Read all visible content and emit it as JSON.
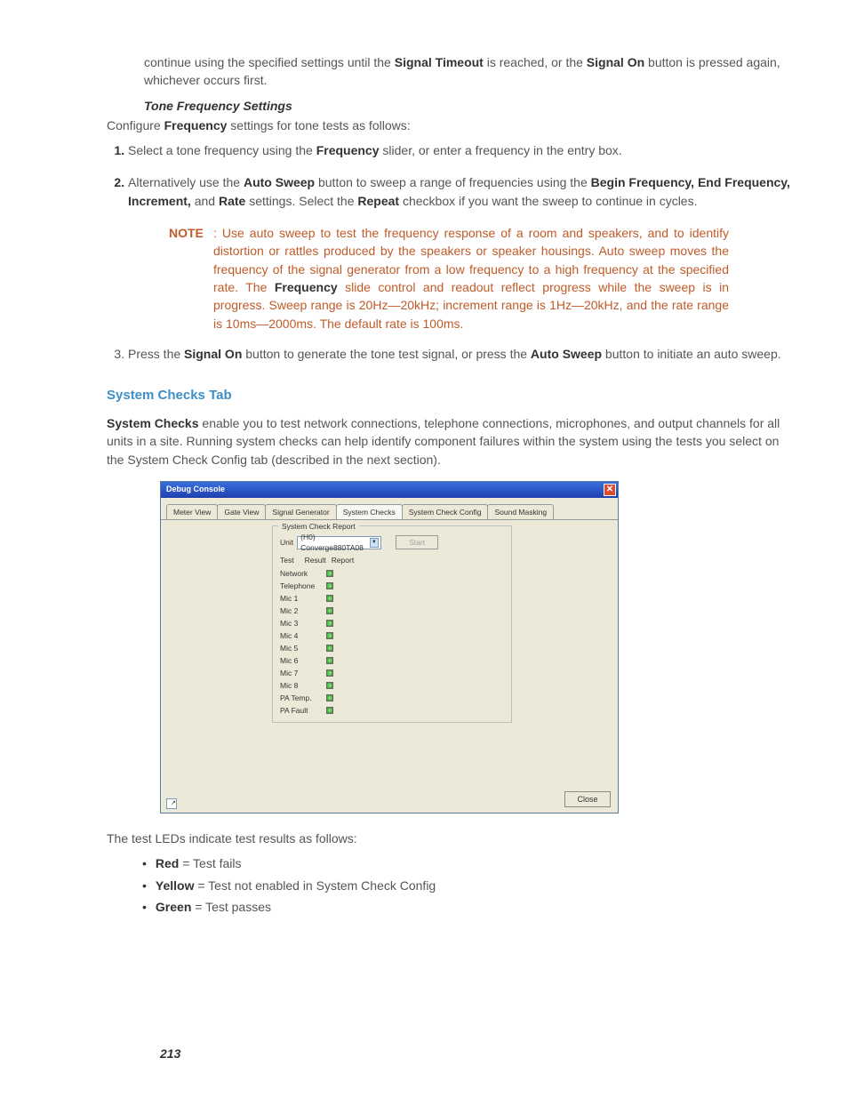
{
  "para_continue_1": "continue using the specified settings until the ",
  "signal_timeout": "Signal Timeout",
  "para_continue_2": " is reached, or the ",
  "signal_on": "Signal On",
  "para_continue_3": " button is pressed again, whichever occurs first.",
  "tone_freq_heading": "Tone Frequency Settings",
  "configure_1": "Configure ",
  "frequency_b": "Frequency",
  "configure_2": " settings for tone tests as follows:",
  "step1_a": "Select a tone frequency using the ",
  "step1_b": " slider, or enter a frequency in the entry box.",
  "step2_a": "Alternatively use the ",
  "auto_sweep": "Auto Sweep",
  "step2_b": " button to sweep a range of frequencies using the ",
  "begin_f": "Begin Frequency, End Frequency, Increment,",
  "and_word": " and ",
  "rate_b": "Rate",
  "step2_c": " settings. Select the ",
  "repeat_b": "Repeat",
  "step2_d": " checkbox if you want the sweep to continue in cycles.",
  "note_label": "NOTE",
  "note_colon": ": ",
  "note_a": "Use auto sweep to test the frequency response of a room and speakers, and to identify distortion or rattles produced by the speakers or speaker housings. Auto sweep moves the frequency of the signal generator from a low frequency to a high frequency at the specified rate. The ",
  "note_b": " slide control and readout reflect progress while the sweep is in progress. Sweep range is 20Hz—20kHz; increment range is 1Hz—20kHz, and the rate range is 10ms—2000ms. The default rate is 100ms.",
  "step3_a": "Press the ",
  "step3_b": " button to generate the tone test signal, or press the ",
  "step3_c": " button to initiate an auto sweep.",
  "checks_heading": "System Checks Tab",
  "checks_b": "System Checks",
  "checks_para": " enable you to test network connections, telephone connections, microphones, and output channels for all units in a site. Running system checks can help identify component failures within the system using the tests you select on the System Check Config tab (described in the next section).",
  "console": {
    "title": "Debug Console",
    "tabs": [
      "Meter View",
      "Gate View",
      "Signal Generator",
      "System Checks",
      "System Check Config",
      "Sound Masking"
    ],
    "active_tab": 3,
    "fieldset_legend": "System Check Report",
    "unit_label": "Unit",
    "unit_value": "(H0) Converge880TA08",
    "start_label": "Start",
    "col_test": "Test",
    "col_result": "Result",
    "col_report": "Report",
    "tests": [
      "Network",
      "Telephone",
      "Mic 1",
      "Mic 2",
      "Mic 3",
      "Mic 4",
      "Mic 5",
      "Mic 6",
      "Mic 7",
      "Mic 8",
      "PA Temp.",
      "PA Fault"
    ],
    "close_label": "Close"
  },
  "leds_intro": "The test LEDs indicate test results as follows:",
  "led_red": "Red",
  "led_red_t": " = Test fails",
  "led_yel": "Yellow",
  "led_yel_t": " = Test not enabled in System Check Config",
  "led_grn": "Green",
  "led_grn_t": " = Test passes",
  "page_number": "213"
}
